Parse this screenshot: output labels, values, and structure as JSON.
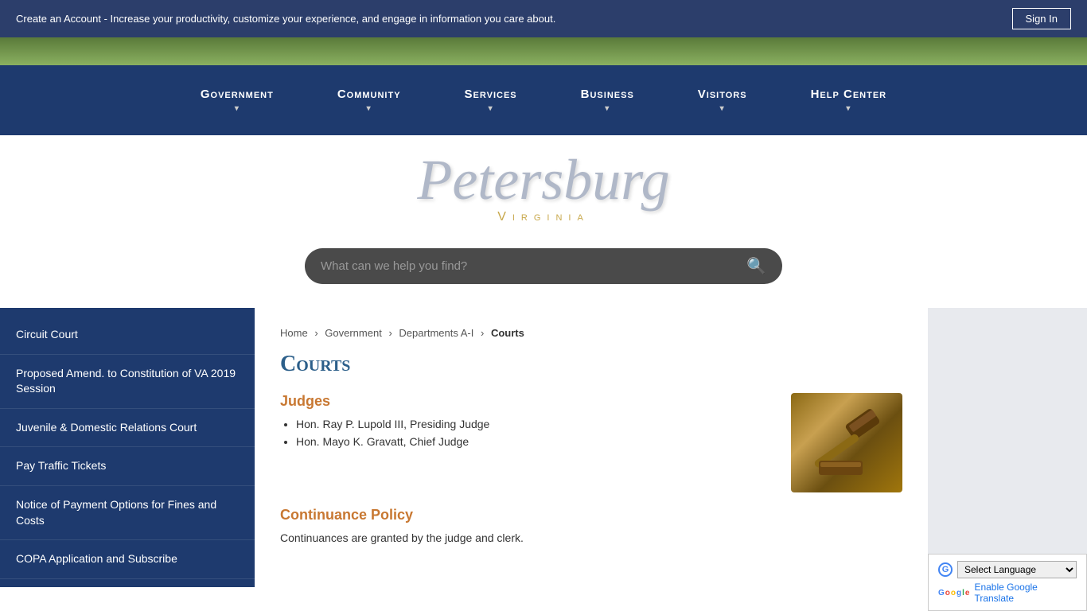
{
  "topBanner": {
    "message": "Create an Account - Increase your productivity, customize your experience, and engage in information you care about.",
    "signInLabel": "Sign In"
  },
  "nav": {
    "items": [
      {
        "label": "Government",
        "id": "government"
      },
      {
        "label": "Community",
        "id": "community"
      },
      {
        "label": "Services",
        "id": "services"
      },
      {
        "label": "Business",
        "id": "business"
      },
      {
        "label": "Visitors",
        "id": "visitors"
      },
      {
        "label": "Help Center",
        "id": "help-center"
      }
    ]
  },
  "logo": {
    "city": "Petersburg",
    "state": "Virginia"
  },
  "search": {
    "placeholder": "What can we help you find?"
  },
  "sidebar": {
    "items": [
      {
        "label": "Circuit Court",
        "id": "circuit-court"
      },
      {
        "label": "Proposed Amend. to Constitution of VA 2019 Session",
        "id": "proposed-amend"
      },
      {
        "label": "Juvenile & Domestic Relations Court",
        "id": "juvenile-court"
      },
      {
        "label": "Pay Traffic Tickets",
        "id": "pay-traffic"
      },
      {
        "label": "Notice of Payment Options for Fines and Costs",
        "id": "payment-notice"
      },
      {
        "label": "COPA Application and Subscribe",
        "id": "copa"
      }
    ]
  },
  "breadcrumb": {
    "items": [
      {
        "label": "Home",
        "href": "#"
      },
      {
        "label": "Government",
        "href": "#"
      },
      {
        "label": "Departments A-I",
        "href": "#"
      },
      {
        "label": "Courts",
        "href": "#",
        "current": true
      }
    ]
  },
  "pageTitle": "Courts",
  "judgesSection": {
    "heading": "Judges",
    "judges": [
      "Hon. Ray P. Lupold III, Presiding Judge",
      "Hon. Mayo K. Gravatt, Chief Judge"
    ]
  },
  "continuanceSection": {
    "heading": "Continuance Policy",
    "text": "Continuances are granted by the judge and clerk."
  },
  "translate": {
    "selectLabel": "Select Language",
    "enableLabel": "Enable Google Translate"
  }
}
